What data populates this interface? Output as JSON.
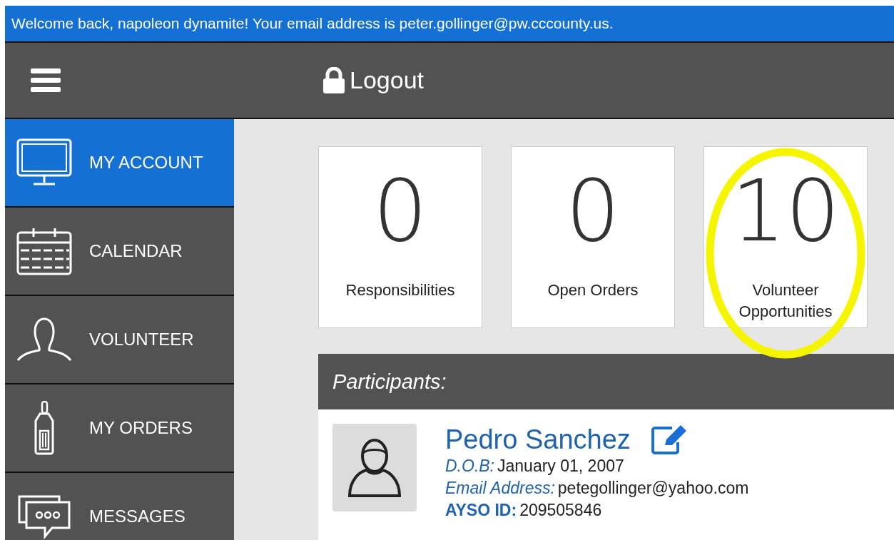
{
  "banner": {
    "text": "Welcome back, napoleon dynamite! Your email address is peter.gollinger@pw.cccounty.us."
  },
  "header": {
    "logout": "Logout"
  },
  "sidebar": {
    "items": [
      {
        "label": "MY ACCOUNT",
        "selected": true
      },
      {
        "label": "CALENDAR",
        "selected": false
      },
      {
        "label": "VOLUNTEER",
        "selected": false
      },
      {
        "label": "MY ORDERS",
        "selected": false
      },
      {
        "label": "MESSAGES",
        "selected": false
      }
    ]
  },
  "stats": [
    {
      "value": "0",
      "label": "Responsibilities",
      "highlighted": false
    },
    {
      "value": "0",
      "label": "Open Orders",
      "highlighted": false
    },
    {
      "value": "10",
      "label": "Volunteer Opportunities",
      "highlighted": true
    }
  ],
  "participants": {
    "title": "Participants:",
    "items": [
      {
        "name": "Pedro Sanchez",
        "fields": [
          {
            "kind": "italic",
            "label": "D.O.B:",
            "value": "January 01, 2007"
          },
          {
            "kind": "italic",
            "label": "Email Address:",
            "value": "petegollinger@yahoo.com"
          },
          {
            "kind": "bold",
            "label": "AYSO ID:",
            "value": "209505846"
          }
        ]
      }
    ]
  }
}
